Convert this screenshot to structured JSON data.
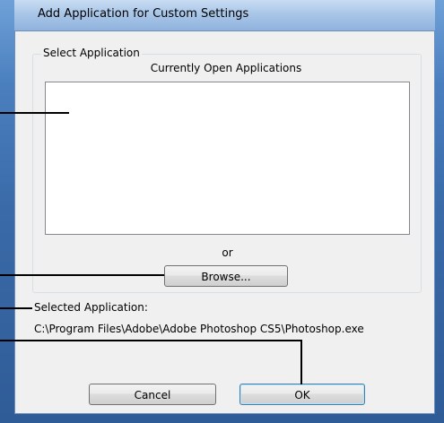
{
  "dialog": {
    "title": "Add Application for Custom Settings"
  },
  "select_group": {
    "legend": "Select Application",
    "list_heading": "Currently Open Applications",
    "list_items": [],
    "or_text": "or",
    "browse_label": "Browse..."
  },
  "selected": {
    "label": "Selected Application:",
    "path": "C:\\Program Files\\Adobe\\Adobe Photoshop CS5\\Photoshop.exe"
  },
  "buttons": {
    "cancel_label": "Cancel",
    "ok_label": "OK"
  }
}
